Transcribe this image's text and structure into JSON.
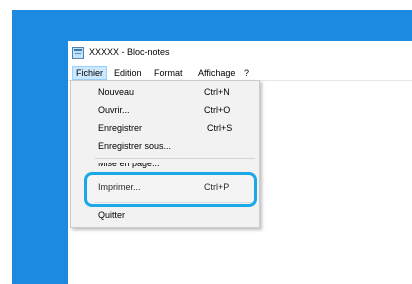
{
  "window": {
    "title": "XXXXX - Bloc-notes",
    "icon": "notepad-icon"
  },
  "menubar": {
    "items": [
      "Fichier",
      "Edition",
      "Format",
      "Affichage",
      "?"
    ],
    "active": "Fichier"
  },
  "file_menu": {
    "items": [
      {
        "label": "Nouveau",
        "shortcut": "Ctrl+N"
      },
      {
        "label": "Ouvrir...",
        "shortcut": "Ctrl+O"
      },
      {
        "label": "Enregistrer",
        "shortcut": "Ctrl+S"
      },
      {
        "label": "Enregistrer sous...",
        "shortcut": ""
      },
      {
        "label": "Mise en page...",
        "shortcut": ""
      },
      {
        "label": "Imprimer...",
        "shortcut": "Ctrl+P"
      },
      {
        "label": "Quitter",
        "shortcut": ""
      }
    ],
    "highlighted": "Imprimer..."
  },
  "colors": {
    "desktop": "#1c8ae0",
    "menu_active_bg": "#cce8ff",
    "highlight_ring": "#1aa8e8"
  }
}
